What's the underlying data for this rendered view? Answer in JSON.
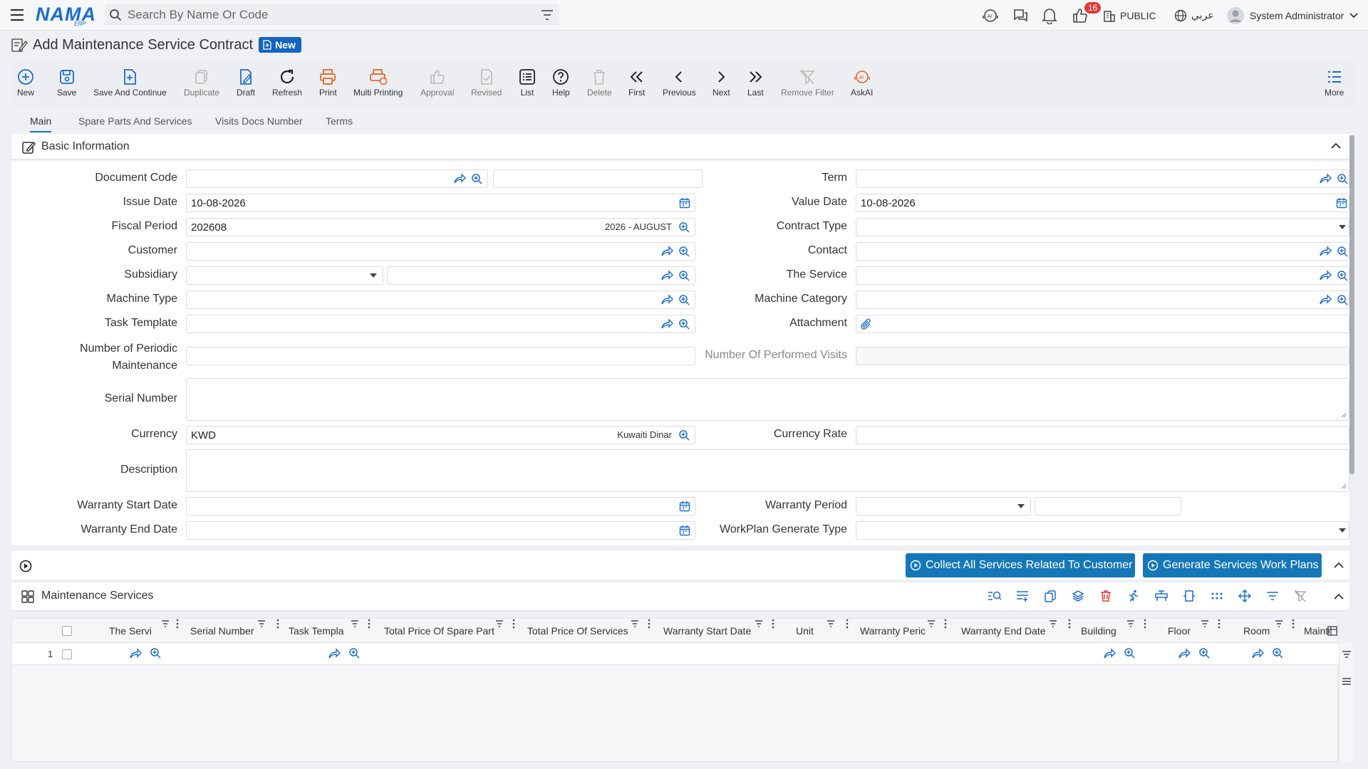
{
  "app": {
    "logo": "NAMA",
    "logo_sub": "ERP",
    "search_placeholder": "Search By Name Or Code",
    "notification_count": "16",
    "branch": "PUBLIC",
    "language": "عربي",
    "user": "System Administrator"
  },
  "page": {
    "title": "Add Maintenance Service Contract",
    "status_badge": "New"
  },
  "toolbar": [
    {
      "label": "New",
      "icon": "add-circle-icon",
      "disabled": false
    },
    {
      "label": "Save",
      "icon": "save-icon",
      "disabled": false
    },
    {
      "label": "Save And Continue",
      "icon": "save-continue-icon",
      "disabled": false
    },
    {
      "label": "Duplicate",
      "icon": "duplicate-icon",
      "disabled": true
    },
    {
      "label": "Draft",
      "icon": "draft-icon",
      "disabled": false
    },
    {
      "label": "Refresh",
      "icon": "refresh-icon",
      "disabled": false
    },
    {
      "label": "Print",
      "icon": "print-icon",
      "disabled": false
    },
    {
      "label": "Multi Printing",
      "icon": "multi-print-icon",
      "disabled": false
    },
    {
      "label": "Approval",
      "icon": "thumbs-up-icon",
      "disabled": true
    },
    {
      "label": "Revised",
      "icon": "revised-icon",
      "disabled": true
    },
    {
      "label": "List",
      "icon": "list-icon",
      "disabled": false
    },
    {
      "label": "Help",
      "icon": "help-icon",
      "disabled": false
    },
    {
      "label": "Delete",
      "icon": "trash-icon",
      "disabled": true
    },
    {
      "label": "First",
      "icon": "double-chevron-left-icon",
      "disabled": false
    },
    {
      "label": "Previous",
      "icon": "chevron-left-icon",
      "disabled": false
    },
    {
      "label": "Next",
      "icon": "chevron-right-icon",
      "disabled": false
    },
    {
      "label": "Last",
      "icon": "double-chevron-right-icon",
      "disabled": false
    },
    {
      "label": "Remove Filter",
      "icon": "remove-filter-icon",
      "disabled": true
    },
    {
      "label": "AskAI",
      "icon": "ai-icon",
      "disabled": false
    },
    {
      "label": "More",
      "icon": "more-list-icon",
      "disabled": false
    }
  ],
  "tabs": [
    "Main",
    "Spare Parts And Services",
    "Visits Docs Number",
    "Terms"
  ],
  "section": {
    "title": "Basic Information"
  },
  "form": {
    "document_code": {
      "label": "Document Code",
      "value": ""
    },
    "issue_date": {
      "label": "Issue Date",
      "value": "10-08-2026"
    },
    "fiscal_period": {
      "label": "Fiscal Period",
      "value": "202608",
      "display": "2026 - AUGUST"
    },
    "customer": {
      "label": "Customer",
      "value": ""
    },
    "subsidiary": {
      "label": "Subsidiary",
      "value": ""
    },
    "machine_type": {
      "label": "Machine Type",
      "value": ""
    },
    "task_template": {
      "label": "Task Template",
      "value": ""
    },
    "periodic_maintenance": {
      "label_line1": "Number of Periodic",
      "label_line2": "Maintenance",
      "value": ""
    },
    "serial_number": {
      "label": "Serial Number",
      "value": ""
    },
    "currency": {
      "label": "Currency",
      "value": "KWD",
      "display": "Kuwaiti Dinar"
    },
    "description": {
      "label": "Description",
      "value": ""
    },
    "warranty_start": {
      "label": "Warranty Start Date",
      "value": ""
    },
    "warranty_end": {
      "label": "Warranty End Date",
      "value": ""
    },
    "term": {
      "label": "Term",
      "value": ""
    },
    "value_date": {
      "label": "Value Date",
      "value": "10-08-2026"
    },
    "contract_type": {
      "label": "Contract Type",
      "value": ""
    },
    "contact": {
      "label": "Contact",
      "value": ""
    },
    "the_service": {
      "label": "The Service",
      "value": ""
    },
    "machine_category": {
      "label": "Machine Category",
      "value": ""
    },
    "attachment": {
      "label": "Attachment",
      "value": ""
    },
    "performed_visits": {
      "label": "Number Of Performed Visits",
      "value": ""
    },
    "currency_rate": {
      "label": "Currency Rate",
      "value": ""
    },
    "warranty_period": {
      "label": "Warranty Period",
      "value": ""
    },
    "workplan_type": {
      "label": "WorkPlan Generate Type",
      "value": ""
    }
  },
  "actions": {
    "collect": "Collect All Services Related To Customer",
    "generate": "Generate Services Work Plans"
  },
  "grid": {
    "title": "Maintenance Services",
    "columns": [
      "The Servi",
      "Serial Number",
      "Task Templa",
      "Total Price Of Spare Part",
      "Total Price Of Services",
      "Warranty Start Date",
      "Unit",
      "Warranty Peric",
      "Warranty End Date",
      "Building",
      "Floor",
      "Room",
      "Maintenai"
    ],
    "rows": [
      {
        "index": "1"
      }
    ]
  },
  "colors": {
    "accent": "#1a6ed1",
    "button": "#1677b8",
    "badge": "#e53935",
    "print": "#e8652b"
  }
}
